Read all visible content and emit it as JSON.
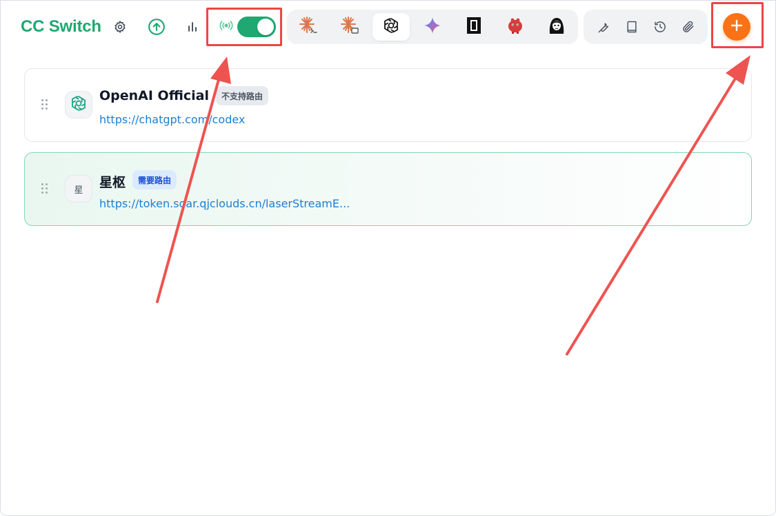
{
  "header": {
    "app_title": "CC Switch",
    "icons": {
      "settings": "gear-icon",
      "update": "arrow-up-circle-icon",
      "usage": "bar-chart-icon",
      "proxy": "broadcast-icon",
      "add": "plus-icon"
    },
    "proxy_toggle": {
      "enabled": true
    },
    "apps": [
      {
        "name": "claude-code-icon",
        "active": false
      },
      {
        "name": "claude-desktop-icon",
        "active": false
      },
      {
        "name": "openai-codex-icon",
        "active": true
      },
      {
        "name": "gemini-icon",
        "active": false
      },
      {
        "name": "opencode-icon",
        "active": false
      },
      {
        "name": "red-mascot-icon",
        "active": false
      },
      {
        "name": "anime-avatar-icon",
        "active": false
      }
    ],
    "tools": [
      "wrench-icon",
      "book-icon",
      "history-icon",
      "paperclip-icon"
    ]
  },
  "providers": [
    {
      "name": "OpenAI Official",
      "badge": "不支持路由",
      "url": "https://chatgpt.com/codex",
      "icon": "openai-logo-icon",
      "active": false
    },
    {
      "name": "星枢",
      "badge": "需要路由",
      "url": "https://token.soar.qjclouds.cn/laserStreamE...",
      "avatar_letter": "星",
      "active": true
    }
  ],
  "colors": {
    "brand": "#1fa871",
    "add_button": "#f97316",
    "annotation": "#ef4444",
    "link": "#1a7fd4"
  }
}
